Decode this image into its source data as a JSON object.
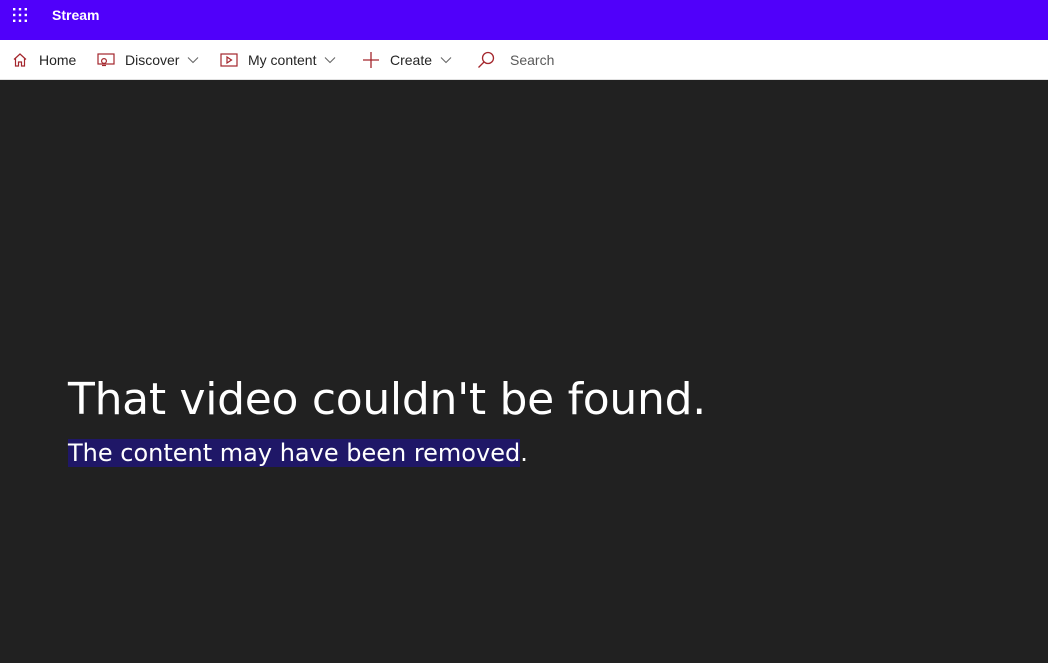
{
  "header": {
    "app_name": "Stream",
    "brand_color": "#5000fa",
    "waffle_icon": "app-launcher-icon"
  },
  "nav": {
    "accent_color": "#a4262c",
    "items": [
      {
        "label": "Home",
        "icon": "home-icon"
      },
      {
        "label": "Discover",
        "icon": "discover-icon",
        "dropdown": true
      },
      {
        "label": "My content",
        "icon": "video-icon",
        "dropdown": true
      },
      {
        "label": "Create",
        "icon": "plus-icon",
        "dropdown": true
      }
    ],
    "search": {
      "label": "Search",
      "icon": "search-icon"
    }
  },
  "error": {
    "title": "That video couldn't be found.",
    "subtitle_selected": "The content may have been removed",
    "subtitle_rest": "."
  }
}
